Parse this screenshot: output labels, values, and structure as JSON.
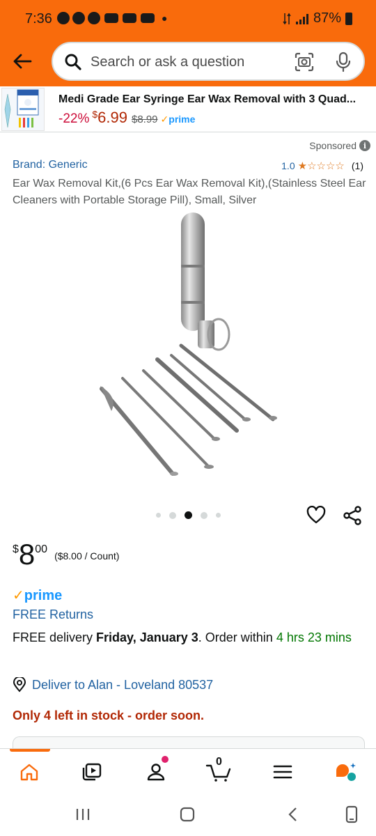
{
  "status_bar": {
    "time": "7:36",
    "battery": "87%"
  },
  "header": {
    "search": {
      "placeholder": "Search or ask a question"
    }
  },
  "sponsored_banner": {
    "title": "Medi Grade Ear Syringe Ear Wax Removal with 3 Quad...",
    "discount": "-22%",
    "price_symbol": "$",
    "price": "6.99",
    "list_price": "$8.99",
    "prime": "prime"
  },
  "product": {
    "sponsored_label": "Sponsored",
    "brand": "Brand: Generic",
    "rating": "1.0",
    "rating_value": 1.0,
    "rating_count": "(1)",
    "title": "Ear Wax Removal Kit,(6 Pcs Ear Wax Removal Kit),(Stainless Steel Ear Cleaners with Portable Storage Pill), Small, Silver",
    "image_index": 3,
    "image_total": 5,
    "price_symbol": "$",
    "price_whole": "8",
    "price_fraction": "00",
    "unit_price": "($8.00 / Count)",
    "prime": "prime",
    "free_returns": "FREE Returns",
    "delivery_prefix": "FREE delivery ",
    "delivery_date": "Friday, January 3",
    "delivery_mid": ". Order within ",
    "delivery_window": "4 hrs 23 mins",
    "deliver_to": "Deliver to Alan - Loveland 80537",
    "stock": "Only 4 left in stock - order soon."
  },
  "bottom_nav": {
    "cart_count": "0"
  },
  "colors": {
    "brand_orange": "#f96b0c",
    "link_blue": "#2162a1",
    "prime_blue": "#1a98ff",
    "price_red": "#b12704",
    "delivery_green": "#007600"
  }
}
